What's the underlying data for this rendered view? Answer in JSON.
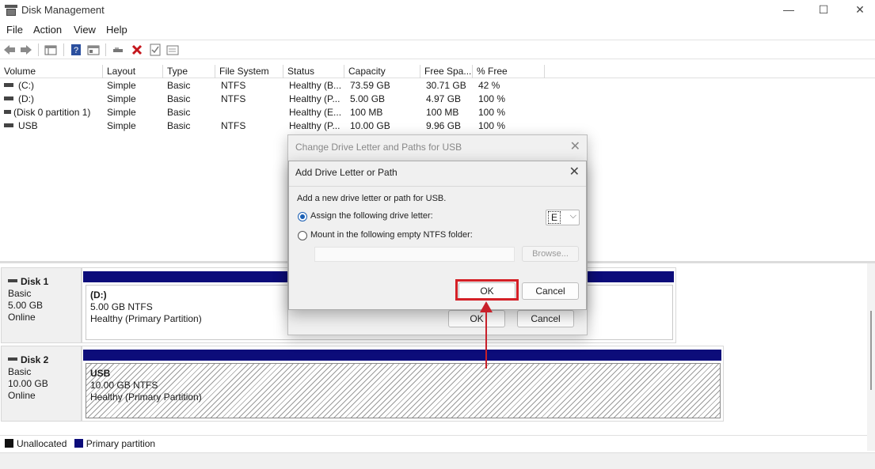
{
  "window": {
    "title": "Disk Management",
    "minimize_glyph": "—",
    "maximize_glyph": "☐",
    "close_glyph": "✕"
  },
  "menu": [
    "File",
    "Action",
    "View",
    "Help"
  ],
  "toolbar_icons": [
    "back-arrow-icon",
    "forward-arrow-icon",
    "console-tree-icon",
    "help-icon",
    "properties-icon",
    "connect-icon",
    "delete-icon",
    "checklist-icon",
    "window-icon"
  ],
  "volumes": {
    "columns": [
      "Volume",
      "Layout",
      "Type",
      "File System",
      "Status",
      "Capacity",
      "Free Spa...",
      "% Free"
    ],
    "rows": [
      {
        "volume": "(C:)",
        "layout": "Simple",
        "type": "Basic",
        "fs": "NTFS",
        "status": "Healthy (B...",
        "capacity": "73.59 GB",
        "free": "30.71 GB",
        "pct": "42 %"
      },
      {
        "volume": "(D:)",
        "layout": "Simple",
        "type": "Basic",
        "fs": "NTFS",
        "status": "Healthy (P...",
        "capacity": "5.00 GB",
        "free": "4.97 GB",
        "pct": "100 %"
      },
      {
        "volume": "(Disk 0 partition 1)",
        "layout": "Simple",
        "type": "Basic",
        "fs": "",
        "status": "Healthy (E...",
        "capacity": "100 MB",
        "free": "100 MB",
        "pct": "100 %"
      },
      {
        "volume": "USB",
        "layout": "Simple",
        "type": "Basic",
        "fs": "NTFS",
        "status": "Healthy (P...",
        "capacity": "10.00 GB",
        "free": "9.96 GB",
        "pct": "100 %"
      }
    ]
  },
  "disks": [
    {
      "name": "Disk 1",
      "kind": "Basic",
      "size": "5.00 GB",
      "state": "Online",
      "partition": {
        "name": "(D:)",
        "size": "5.00 GB NTFS",
        "status": "Healthy (Primary Partition)"
      }
    },
    {
      "name": "Disk 2",
      "kind": "Basic",
      "size": "10.00 GB",
      "state": "Online",
      "partition": {
        "name": "USB",
        "size": "10.00 GB NTFS",
        "status": "Healthy (Primary Partition)"
      }
    }
  ],
  "legend": {
    "unallocated": "Unallocated",
    "primary": "Primary partition"
  },
  "colors": {
    "primary_partition": "#0c0c7a",
    "unallocated": "#111111",
    "highlight": "#d42027"
  },
  "dialog_back": {
    "title": "Change Drive Letter and Paths for USB",
    "ok_label": "OK",
    "cancel_label": "Cancel"
  },
  "dialog_front": {
    "title": "Add Drive Letter or Path",
    "prompt": "Add a new drive letter or path for USB.",
    "option_assign": "Assign the following drive letter:",
    "option_mount": "Mount in the following empty NTFS folder:",
    "drive_letter": "E",
    "browse_label": "Browse...",
    "ok_label": "OK",
    "cancel_label": "Cancel"
  }
}
